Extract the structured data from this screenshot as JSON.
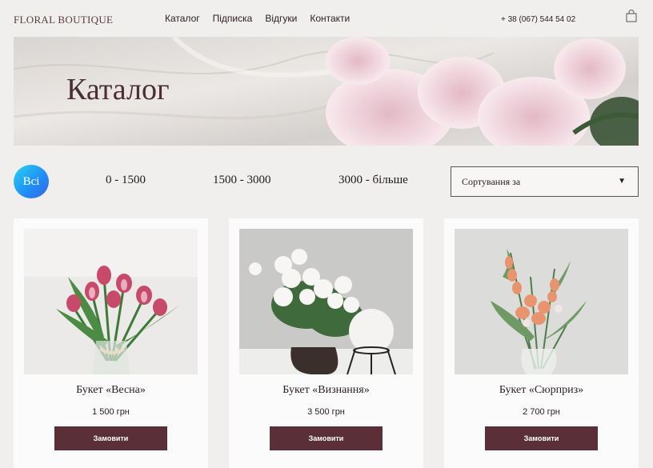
{
  "header": {
    "logo": "FLORAL BOUTIQUE",
    "nav": [
      {
        "label": "Каталог"
      },
      {
        "label": "Підписка"
      },
      {
        "label": "Відгуки"
      },
      {
        "label": "Контакти"
      }
    ],
    "phone": "+ 38 (067) 544 54 02",
    "cart_icon": "shopping-bag-icon"
  },
  "hero": {
    "title": "Каталог"
  },
  "filters": {
    "all": "Всі",
    "ranges": [
      "0 - 1500",
      "1500 - 3000",
      "3000 - більше"
    ],
    "sort_label": "Сортування за",
    "sort_arrow": "▼"
  },
  "products": [
    {
      "name": "Букет «Весна»",
      "price": "1 500 грн",
      "button": "Замовити"
    },
    {
      "name": "Букет «Визнання»",
      "price": "3 500 грн",
      "button": "Замовити"
    },
    {
      "name": "Букет «Сюрприз»",
      "price": "2 700 грн",
      "button": "Замовити"
    }
  ],
  "colors": {
    "background": "#f0efee",
    "accent": "#5a2f37",
    "filter_gradient_start": "#2ad2f0",
    "filter_gradient_end": "#3a62e6"
  }
}
